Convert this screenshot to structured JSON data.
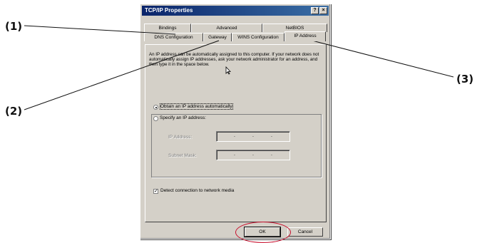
{
  "callouts": {
    "c1": "(1)",
    "c2": "(2)",
    "c3": "(3)"
  },
  "window": {
    "title": "TCP/IP Properties",
    "help_button": "?",
    "close_button": "×"
  },
  "tabs": {
    "back_row": [
      "Bindings",
      "Advanced",
      "NetBIOS"
    ],
    "front_row": [
      "DNS Configuration",
      "Gateway",
      "WINS Configuration",
      "IP Address"
    ],
    "active": "IP Address"
  },
  "panel": {
    "description": "An IP address can be automatically assigned to this computer. If your network does not automatically assign IP addresses, ask your network administrator for an address, and then type it in the space below.",
    "obtain_label": "Obtain an IP address automatically",
    "specify_label": "Specify an IP address:",
    "ip_label": "IP Address:",
    "subnet_label": "Subnet Mask:",
    "ip_dots": ". . .",
    "detect_label": "Detect connection to network media",
    "detect_checked": "✓"
  },
  "buttons": {
    "ok": "OK",
    "cancel": "Cancel"
  },
  "colors": {
    "dialog_bg": "#d4d0c8",
    "title_bar": "#0a246a",
    "highlight_circle": "#c8102e"
  }
}
